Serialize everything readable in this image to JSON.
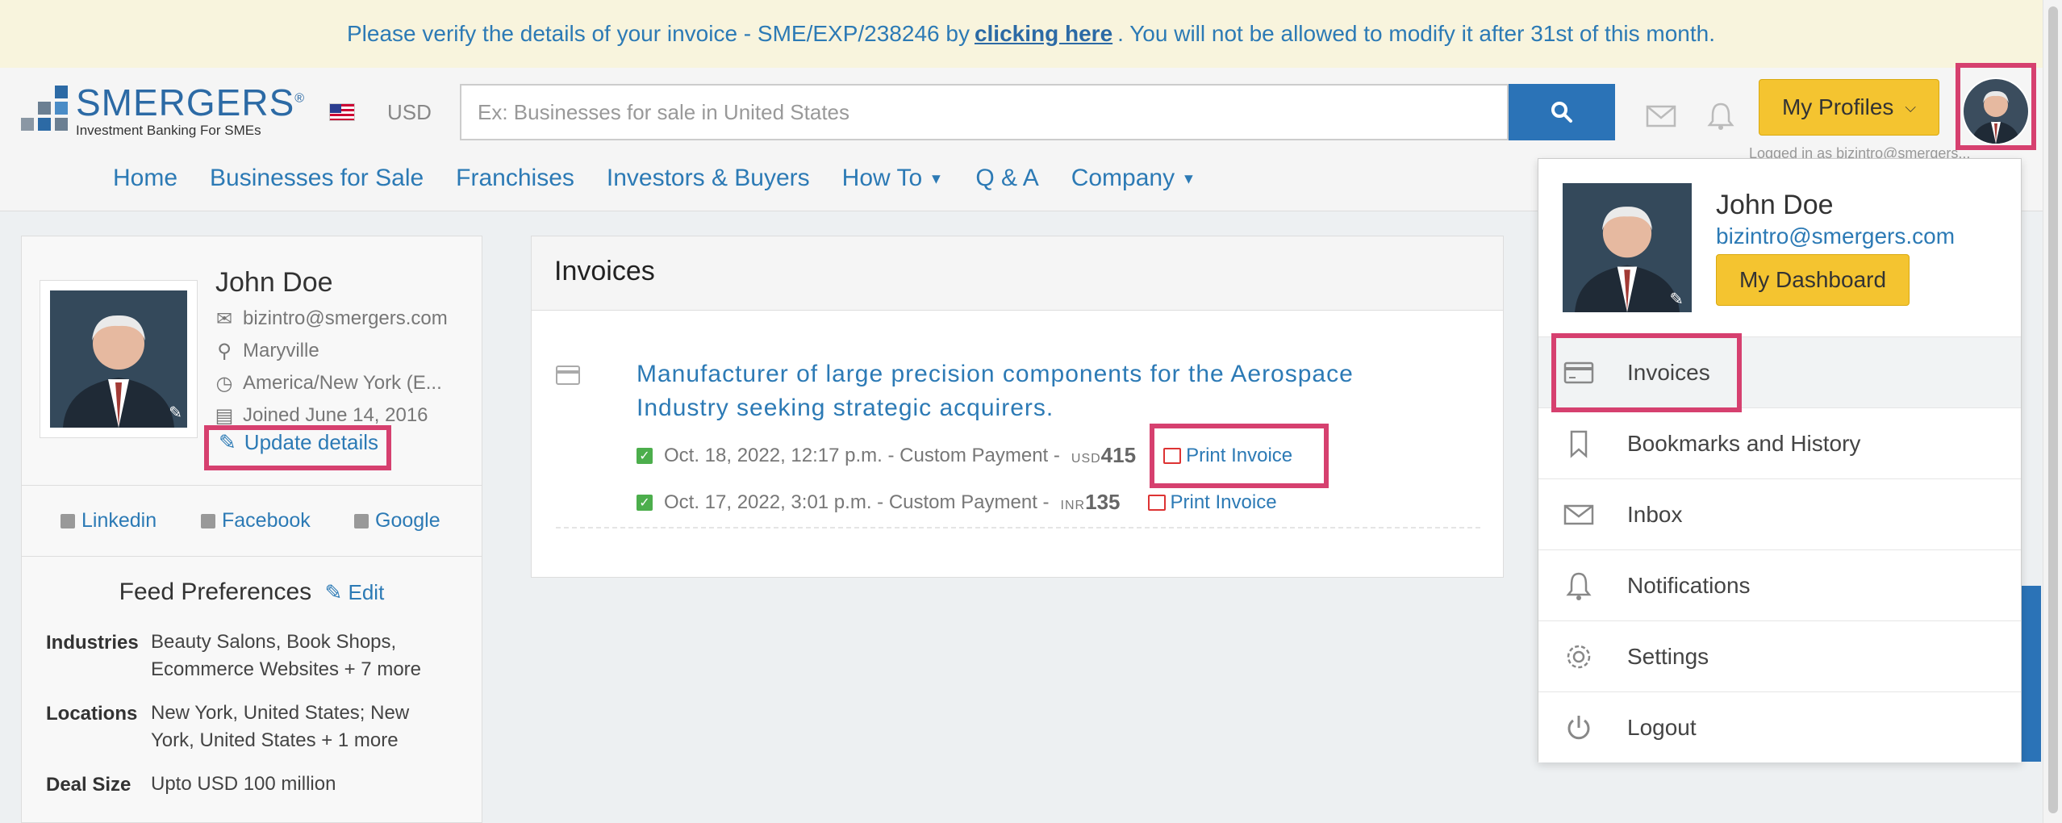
{
  "notice": {
    "prefix": "Please verify the details of your invoice - SME/EXP/238246 by",
    "link": "clicking here",
    "suffix": ". You will not be allowed to modify it after 31st of this month."
  },
  "header": {
    "logo_text": "SMERGERS",
    "logo_reg": "®",
    "logo_tagline": "Investment Banking For SMEs",
    "currency": "USD",
    "search_placeholder": "Ex: Businesses for sale in United States",
    "profiles_label": "My Profiles",
    "logged_in_as": "Logged in as bizintro@smergers..."
  },
  "nav": {
    "home": "Home",
    "businesses": "Businesses for Sale",
    "franchises": "Franchises",
    "investors": "Investors & Buyers",
    "howto": "How To",
    "qa": "Q & A",
    "company": "Company"
  },
  "profile": {
    "name": "John Doe",
    "email": "bizintro@smergers.com",
    "location": "Maryville",
    "timezone": "America/New York (E...",
    "joined": "Joined June 14, 2016",
    "update_label": "Update details",
    "social": {
      "linkedin": "Linkedin",
      "facebook": "Facebook",
      "google": "Google"
    },
    "feed_title": "Feed Preferences",
    "feed_edit": "Edit",
    "prefs": {
      "industries_label": "Industries",
      "industries_value": "Beauty Salons, Book Shops, Ecommerce Websites + 7 more",
      "locations_label": "Locations",
      "locations_value": "New York, United States; New York, United States + 1 more",
      "deal_label": "Deal Size",
      "deal_value": "Upto USD 100 million"
    }
  },
  "invoices": {
    "heading": "Invoices",
    "title": "Manufacturer of large precision components for the Aerospace Industry seeking strategic acquirers.",
    "rows": [
      {
        "date": "Oct. 18, 2022, 12:17 p.m. - Custom Payment -",
        "currency": "USD",
        "amount": "415",
        "print": "Print Invoice"
      },
      {
        "date": "Oct. 17, 2022, 3:01 p.m. - Custom Payment -",
        "currency": "INR",
        "amount": "135",
        "print": "Print Invoice"
      }
    ]
  },
  "dropdown": {
    "name": "John Doe",
    "email": "bizintro@smergers.com",
    "dashboard": "My Dashboard",
    "items": [
      {
        "label": "Invoices",
        "icon": "credit-card-icon"
      },
      {
        "label": "Bookmarks and History",
        "icon": "bookmark-icon"
      },
      {
        "label": "Inbox",
        "icon": "envelope-icon"
      },
      {
        "label": "Notifications",
        "icon": "bell-icon"
      },
      {
        "label": "Settings",
        "icon": "gear-icon"
      },
      {
        "label": "Logout",
        "icon": "power-icon"
      }
    ]
  },
  "colors": {
    "accent": "#2c7ab5",
    "button_yellow": "#f4c430",
    "highlight": "#d6406f",
    "notice_bg": "#f8f4dd"
  }
}
